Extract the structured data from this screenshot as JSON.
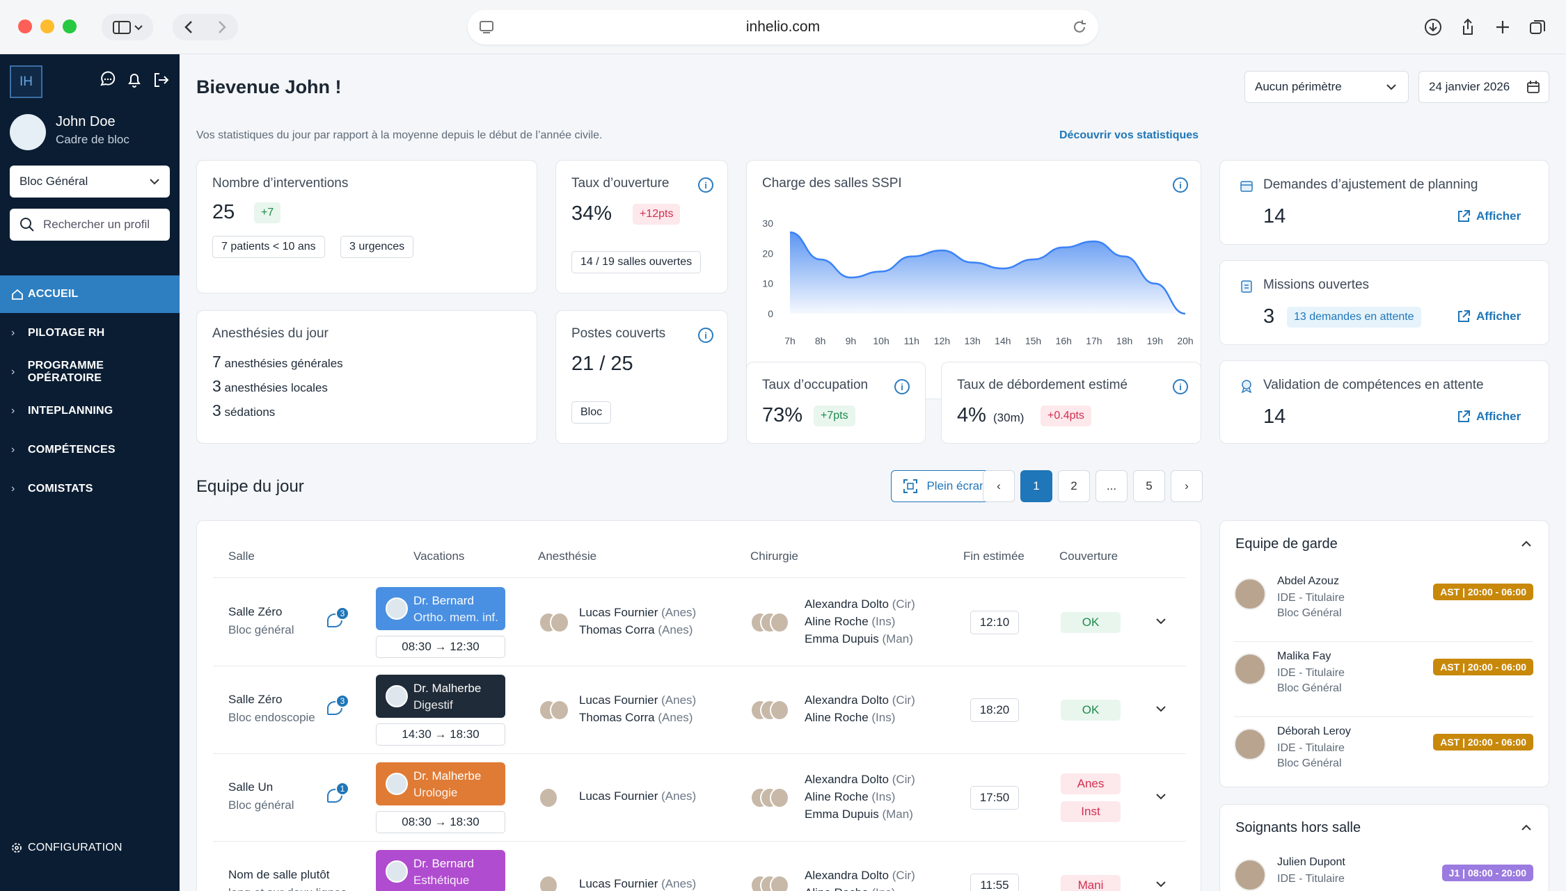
{
  "browser": {
    "url": "inhelio.com"
  },
  "sidebar": {
    "logo": "IH",
    "user": {
      "name": "John Doe",
      "role": "Cadre de bloc"
    },
    "bloc_select": "Bloc Général",
    "search_placeholder": "Rechercher un profil",
    "nav": [
      "ACCUEIL",
      "PILOTAGE RH",
      "PROGRAMME OPÉRATOIRE",
      "INTEPLANNING",
      "COMPÉTENCES",
      "COMISTATS"
    ],
    "config": "CONFIGURATION"
  },
  "header": {
    "greeting": "Bievenue John !",
    "subtitle": "Vos statistiques du jour par rapport à la moyenne depuis le début de l’année civile.",
    "stats_link": "Découvrir vos statistiques",
    "perimetre": "Aucun périmètre",
    "date": "24 janvier 2026"
  },
  "cards": {
    "interventions": {
      "title": "Nombre d’interventions",
      "value": "25",
      "delta": "+7",
      "tag1": "7 patients < 10 ans",
      "tag2": "3 urgences"
    },
    "ouverture": {
      "title": "Taux d’ouverture",
      "value": "34%",
      "delta": "+12pts",
      "tag": "14 / 19 salles ouvertes"
    },
    "anesthesies": {
      "title": "Anesthésies du jour",
      "lines": [
        {
          "n": "7",
          "t": "anesthésies générales"
        },
        {
          "n": "3",
          "t": "anesthésies locales"
        },
        {
          "n": "3",
          "t": "sédations"
        }
      ]
    },
    "postes": {
      "title": "Postes couverts",
      "value": "21 / 25",
      "tag": "Bloc"
    },
    "occupation": {
      "title": "Taux d’occupation",
      "value": "73%",
      "delta": "+7pts"
    },
    "debordement": {
      "title": "Taux de débordement estimé",
      "value": "4%",
      "sub": "(30m)",
      "delta": "+0.4pts"
    },
    "ajustement": {
      "title": "Demandes d’ajustement de planning",
      "value": "14",
      "action": "Afficher"
    },
    "missions": {
      "title": "Missions ouvertes",
      "value": "3",
      "badge": "13 demandes en attente",
      "action": "Afficher"
    },
    "competences": {
      "title": "Validation de compétences en attente",
      "value": "14",
      "action": "Afficher"
    }
  },
  "chart_data": {
    "type": "area",
    "title": "Charge des salles SSPI",
    "categories": [
      "7h",
      "8h",
      "9h",
      "10h",
      "11h",
      "12h",
      "13h",
      "14h",
      "15h",
      "16h",
      "17h",
      "18h",
      "19h",
      "20h"
    ],
    "values": [
      27,
      18,
      12,
      14,
      19,
      21,
      17,
      15,
      18,
      22,
      24,
      19,
      10,
      0
    ],
    "ylim": [
      0,
      30
    ],
    "yticks": [
      "30",
      "20",
      "10",
      "0"
    ],
    "color": "#3b82f6"
  },
  "team": {
    "title": "Equipe du jour",
    "fullscreen": "Plein écran",
    "pages": [
      "1",
      "2",
      "...",
      "5"
    ],
    "columns": [
      "Salle",
      "Vacations",
      "Anesthésie",
      "Chirurgie",
      "Fin estimée",
      "Couverture"
    ],
    "rows": [
      {
        "salle": "Salle Zéro",
        "bloc": "Bloc général",
        "msgs": "3",
        "doctor": "Dr. Bernard",
        "spec": "Ortho. mem. inf.",
        "color": "#4a90e2",
        "time": "08:30 → 12:30",
        "anes": [
          {
            "n": "Lucas Fournier",
            "r": " (Anes)"
          },
          {
            "n": "Thomas Corra",
            "r": " (Anes)"
          }
        ],
        "chir": [
          {
            "n": "Alexandra Dolto",
            "r": " (Cir)"
          },
          {
            "n": "Aline Roche",
            "r": " (Ins)"
          },
          {
            "n": "Emma Dupuis",
            "r": " (Man)"
          }
        ],
        "fin": "12:10",
        "cov": [
          "OK"
        ]
      },
      {
        "salle": "Salle Zéro",
        "bloc": "Bloc endoscopie",
        "msgs": "3",
        "doctor": "Dr. Malherbe",
        "spec": "Digestif",
        "color": "#1f2b38",
        "time": "14:30 → 18:30",
        "anes": [
          {
            "n": "Lucas Fournier",
            "r": " (Anes)"
          },
          {
            "n": "Thomas Corra",
            "r": " (Anes)"
          }
        ],
        "chir": [
          {
            "n": "Alexandra Dolto",
            "r": " (Cir)"
          },
          {
            "n": "Aline Roche",
            "r": " (Ins)"
          }
        ],
        "fin": "18:20",
        "cov": [
          "OK"
        ]
      },
      {
        "salle": "Salle Un",
        "bloc": "Bloc général",
        "msgs": "1",
        "doctor": "Dr. Malherbe",
        "spec": "Urologie",
        "color": "#e07b35",
        "time": "08:30 → 18:30",
        "anes": [
          {
            "n": "Lucas Fournier",
            "r": " (Anes)"
          }
        ],
        "chir": [
          {
            "n": "Alexandra Dolto",
            "r": " (Cir)"
          },
          {
            "n": "Aline Roche",
            "r": " (Ins)"
          },
          {
            "n": "Emma Dupuis",
            "r": " (Man)"
          }
        ],
        "fin": "17:50",
        "cov": [
          "Anes",
          "Inst"
        ]
      },
      {
        "salle": "Nom de salle plutôt",
        "bloc": "long et sur deux lignes",
        "msgs": "",
        "doctor": "Dr. Bernard",
        "spec": "Esthétique",
        "color": "#b04ccf",
        "time": "",
        "anes": [
          {
            "n": "Lucas Fournier",
            "r": " (Anes)"
          }
        ],
        "chir": [
          {
            "n": "Alexandra Dolto",
            "r": " (Cir)"
          },
          {
            "n": "Aline Roche",
            "r": " (Ins)"
          }
        ],
        "fin": "11:55",
        "cov": [
          "Mani"
        ]
      }
    ]
  },
  "garde": {
    "title": "Equipe de garde",
    "people": [
      {
        "name": "Abdel Azouz",
        "role": "IDE - Titulaire",
        "loc": "Bloc Général",
        "tag": "AST | 20:00 - 06:00"
      },
      {
        "name": "Malika Fay",
        "role": "IDE - Titulaire",
        "loc": "Bloc Général",
        "tag": "AST | 20:00 - 06:00"
      },
      {
        "name": "Déborah Leroy",
        "role": "IDE - Titulaire",
        "loc": "Bloc Général",
        "tag": "AST | 20:00 - 06:00"
      }
    ],
    "tag_color": "#c8880a"
  },
  "hors_salle": {
    "title": "Soignants hors salle",
    "people": [
      {
        "name": "Julien Dupont",
        "role": "IDE - Titulaire",
        "tag": "J1 | 08:00 - 20:00"
      }
    ],
    "tag_color": "#9b7be0"
  }
}
